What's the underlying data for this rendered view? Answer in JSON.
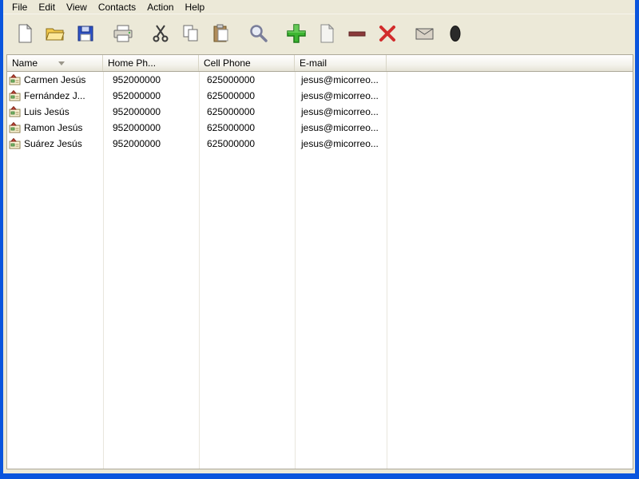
{
  "window": {
    "background_color": "#ece9d8",
    "frame_color": "#0a55dd",
    "list_background": "#ffffff"
  },
  "menu": {
    "items": [
      "File",
      "Edit",
      "View",
      "Contacts",
      "Action",
      "Help"
    ]
  },
  "toolbar": {
    "icons": [
      "new-icon",
      "open-icon",
      "save-icon",
      "print-icon",
      "cut-icon",
      "copy-icon",
      "paste-icon",
      "search-icon",
      "add-contact-icon",
      "edit-contact-icon",
      "remove-contact-icon",
      "delete-icon",
      "mail-icon",
      "phone-icon"
    ]
  },
  "table": {
    "columns": [
      "Name",
      "Home Ph...",
      "Cell Phone",
      "E-mail"
    ],
    "sorted_column": "Name",
    "rows": [
      {
        "name": "Carmen Jesús",
        "home_phone": "952000000",
        "cell_phone": "625000000",
        "email": "jesus@micorreo..."
      },
      {
        "name": "Fernández J...",
        "home_phone": "952000000",
        "cell_phone": "625000000",
        "email": "jesus@micorreo..."
      },
      {
        "name": "Luis Jesús",
        "home_phone": "952000000",
        "cell_phone": "625000000",
        "email": "jesus@micorreo..."
      },
      {
        "name": "Ramon Jesús",
        "home_phone": "952000000",
        "cell_phone": "625000000",
        "email": "jesus@micorreo..."
      },
      {
        "name": "Suárez Jesús",
        "home_phone": "952000000",
        "cell_phone": "625000000",
        "email": "jesus@micorreo..."
      }
    ]
  }
}
